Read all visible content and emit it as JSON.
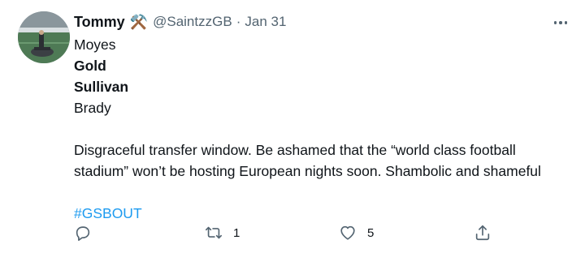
{
  "tweet": {
    "display_name": "Tommy",
    "name_emoji": "⚒️",
    "handle": "@SaintzzGB",
    "separator": "·",
    "date": "Jan 31",
    "lines": [
      {
        "text": "Moyes",
        "bold": false
      },
      {
        "text": "Gold",
        "bold": true
      },
      {
        "text": "Sullivan",
        "bold": true
      },
      {
        "text": "Brady",
        "bold": false
      }
    ],
    "paragraph_line1": "Disgraceful transfer window. Be ashamed that the “world class football",
    "paragraph_line2": "stadium” won’t be hosting European nights soon. Shambolic and shameful",
    "hashtag": "#GSBOUT",
    "actions": {
      "reply_icon": "reply-icon",
      "retweet_icon": "retweet-icon",
      "retweet_count": "1",
      "like_icon": "heart-icon",
      "like_count": "5",
      "share_icon": "share-icon"
    },
    "colors": {
      "text": "#0f1419",
      "secondary": "#536471",
      "link": "#1d9bf0"
    }
  }
}
